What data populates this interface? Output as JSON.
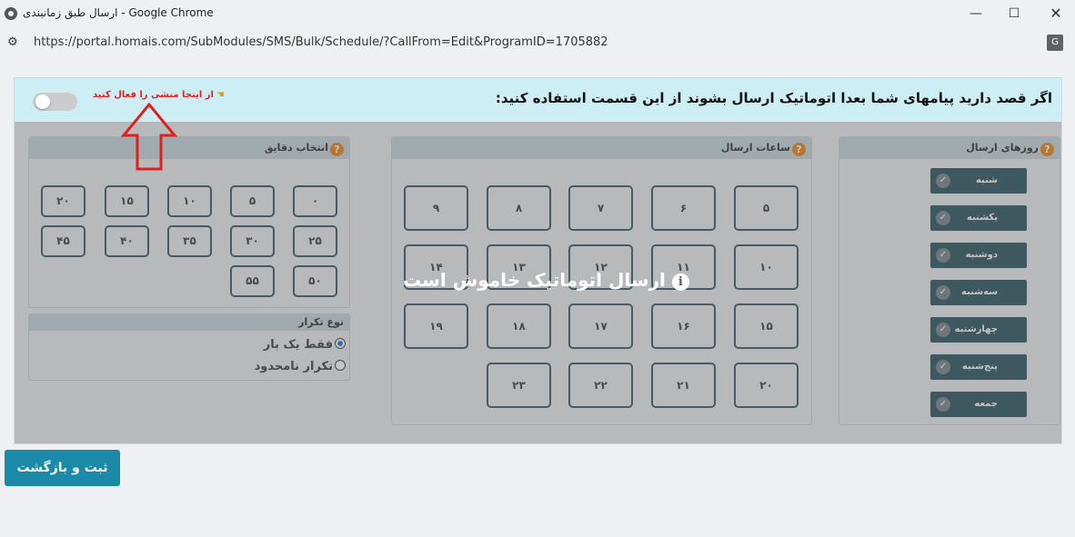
{
  "window": {
    "title": "ارسال طبق زمانبندی - Google Chrome",
    "url": "https://portal.homais.com/SubModules/SMS/Bulk/Schedule/?CallFrom=Edit&ProgramID=1705882"
  },
  "info_bar": {
    "text": "اگر قصد دارید پیامهای شما بعدا اتوماتیک ارسال بشوند از این قسمت استفاده کنید:",
    "hint": "از اینجا منشی را فعال کنید",
    "toggle_on": false
  },
  "days": {
    "title": "روزهای ارسال",
    "items": [
      "شنبه",
      "یکشنبه",
      "دوشنبه",
      "سه‌شنبه",
      "چهارشنبه",
      "پنج‌شنبه",
      "جمعه"
    ]
  },
  "hours": {
    "title": "ساعات ارسال",
    "items": [
      "۵",
      "۶",
      "۷",
      "۸",
      "۹",
      "۱۰",
      "۱۱",
      "۱۲",
      "۱۳",
      "۱۴",
      "۱۵",
      "۱۶",
      "۱۷",
      "۱۸",
      "۱۹",
      "۲۰",
      "۲۱",
      "۲۲",
      "۲۳"
    ]
  },
  "minutes": {
    "title": "انتخاب دقایق",
    "items": [
      "۰",
      "۵",
      "۱۰",
      "۱۵",
      "۲۰",
      "۲۵",
      "۳۰",
      "۳۵",
      "۴۰",
      "۴۵",
      "۵۰",
      "۵۵"
    ]
  },
  "repeat": {
    "title": "نوع تکرار",
    "options": [
      {
        "label": "فقط یک بار",
        "selected": true
      },
      {
        "label": "تکرار نامحدود",
        "selected": false
      }
    ]
  },
  "overlay": {
    "message": "ارسال اتوماتیک خاموش است"
  },
  "submit_label": "ثبت و بازگشت",
  "colors": {
    "accent": "#1a8aa8",
    "day_button": "#1f4a56",
    "info_bar": "#cdeef5",
    "hint_text": "#e02020",
    "help_icon": "#e87c0a"
  }
}
